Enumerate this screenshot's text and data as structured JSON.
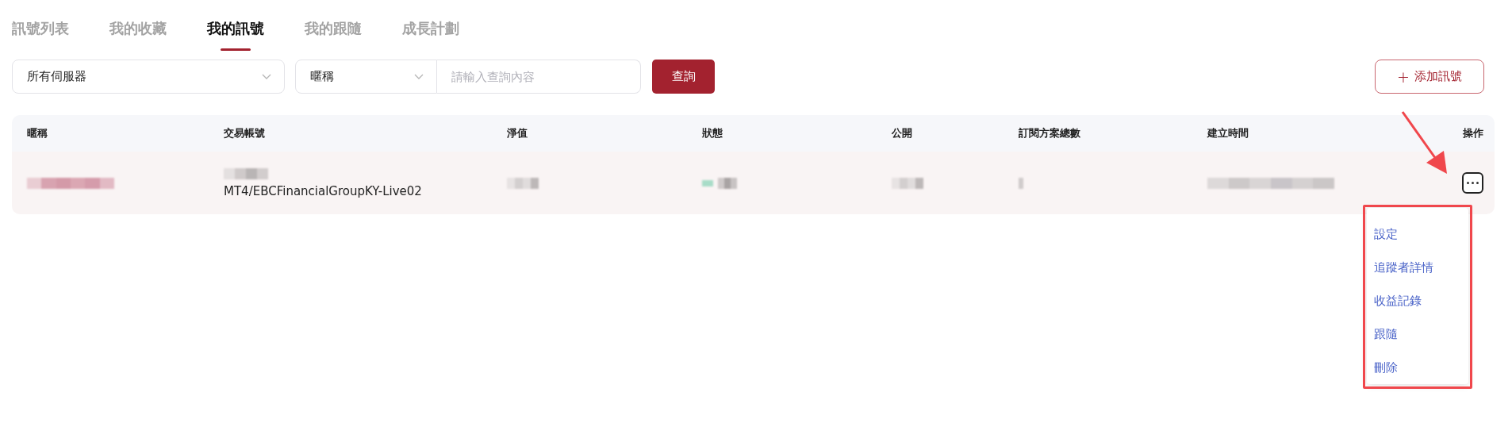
{
  "tabs": [
    {
      "label": "訊號列表",
      "selected": false
    },
    {
      "label": "我的收藏",
      "selected": false
    },
    {
      "label": "我的訊號",
      "selected": true
    },
    {
      "label": "我的跟隨",
      "selected": false
    },
    {
      "label": "成長計劃",
      "selected": false
    }
  ],
  "filters": {
    "server_select": {
      "value": "所有伺服器"
    },
    "field_select": {
      "value": "暱稱"
    },
    "search": {
      "placeholder": "請輸入查詢內容"
    },
    "query_button": "查詢",
    "add_button": {
      "icon": "+",
      "label": "添加訊號"
    }
  },
  "table": {
    "columns": [
      "暱稱",
      "交易帳號",
      "淨值",
      "狀態",
      "公開",
      "訂閱方案總數",
      "建立時間",
      "操作"
    ],
    "rows": [
      {
        "cells": [
          {
            "kind": "redacted-link"
          },
          {
            "kind": "redacted-over-text",
            "text": "MT4/EBCFinancialGroupKY-Live02"
          },
          {
            "kind": "redacted"
          },
          {
            "kind": "redacted-status"
          },
          {
            "kind": "redacted"
          },
          {
            "kind": "redacted-short"
          },
          {
            "kind": "redacted-long"
          },
          {
            "kind": "more-button"
          }
        ]
      }
    ]
  },
  "action_menu": {
    "items": [
      {
        "label": "設定"
      },
      {
        "label": "追蹤者詳情"
      },
      {
        "label": "收益記錄"
      },
      {
        "label": "跟隨"
      },
      {
        "label": "刪除"
      }
    ]
  },
  "annotations": {
    "arrow": true,
    "frame": true
  }
}
